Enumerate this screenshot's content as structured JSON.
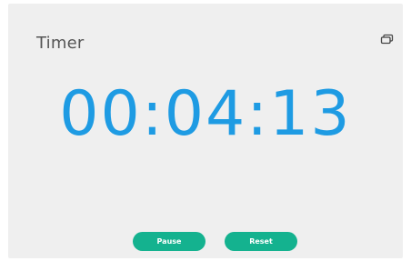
{
  "app": {
    "title": "Timer"
  },
  "timer": {
    "display": "00:04:13"
  },
  "controls": {
    "pause_label": "Pause",
    "reset_label": "Reset"
  },
  "icons": {
    "window": "restore-window-icon"
  },
  "colors": {
    "background": "#efefef",
    "time_text": "#1e9be3",
    "button": "#14b28f",
    "title_text": "#555555"
  }
}
